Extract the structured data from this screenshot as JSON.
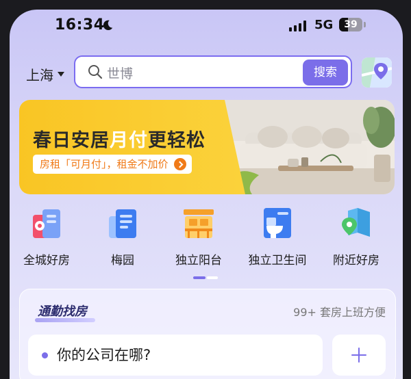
{
  "status": {
    "time": "16:34",
    "network": "5G",
    "battery": "39",
    "battery_level": 0.39
  },
  "header": {
    "city": "上海",
    "search_placeholder": "世博",
    "search_button": "搜索"
  },
  "banner": {
    "headline_a": "春日安居",
    "headline_hl": "月付",
    "headline_b": "更轻松",
    "subline": "房租「可月付」，租金不加价"
  },
  "categories": [
    {
      "label": "全城好房",
      "icon": "city-houses-icon"
    },
    {
      "label": "梅园",
      "icon": "building-icon"
    },
    {
      "label": "独立阳台",
      "icon": "balcony-icon"
    },
    {
      "label": "独立卫生间",
      "icon": "toilet-icon"
    },
    {
      "label": "附近好房",
      "icon": "nearby-map-icon"
    }
  ],
  "commute": {
    "title": "通勤找房",
    "tagline": "99+ 套房上班方便",
    "question": "你的公司在哪?"
  },
  "colors": {
    "accent": "#7b6ee9",
    "banner_yellow": "#f9c524",
    "banner_orange": "#f07a18"
  }
}
